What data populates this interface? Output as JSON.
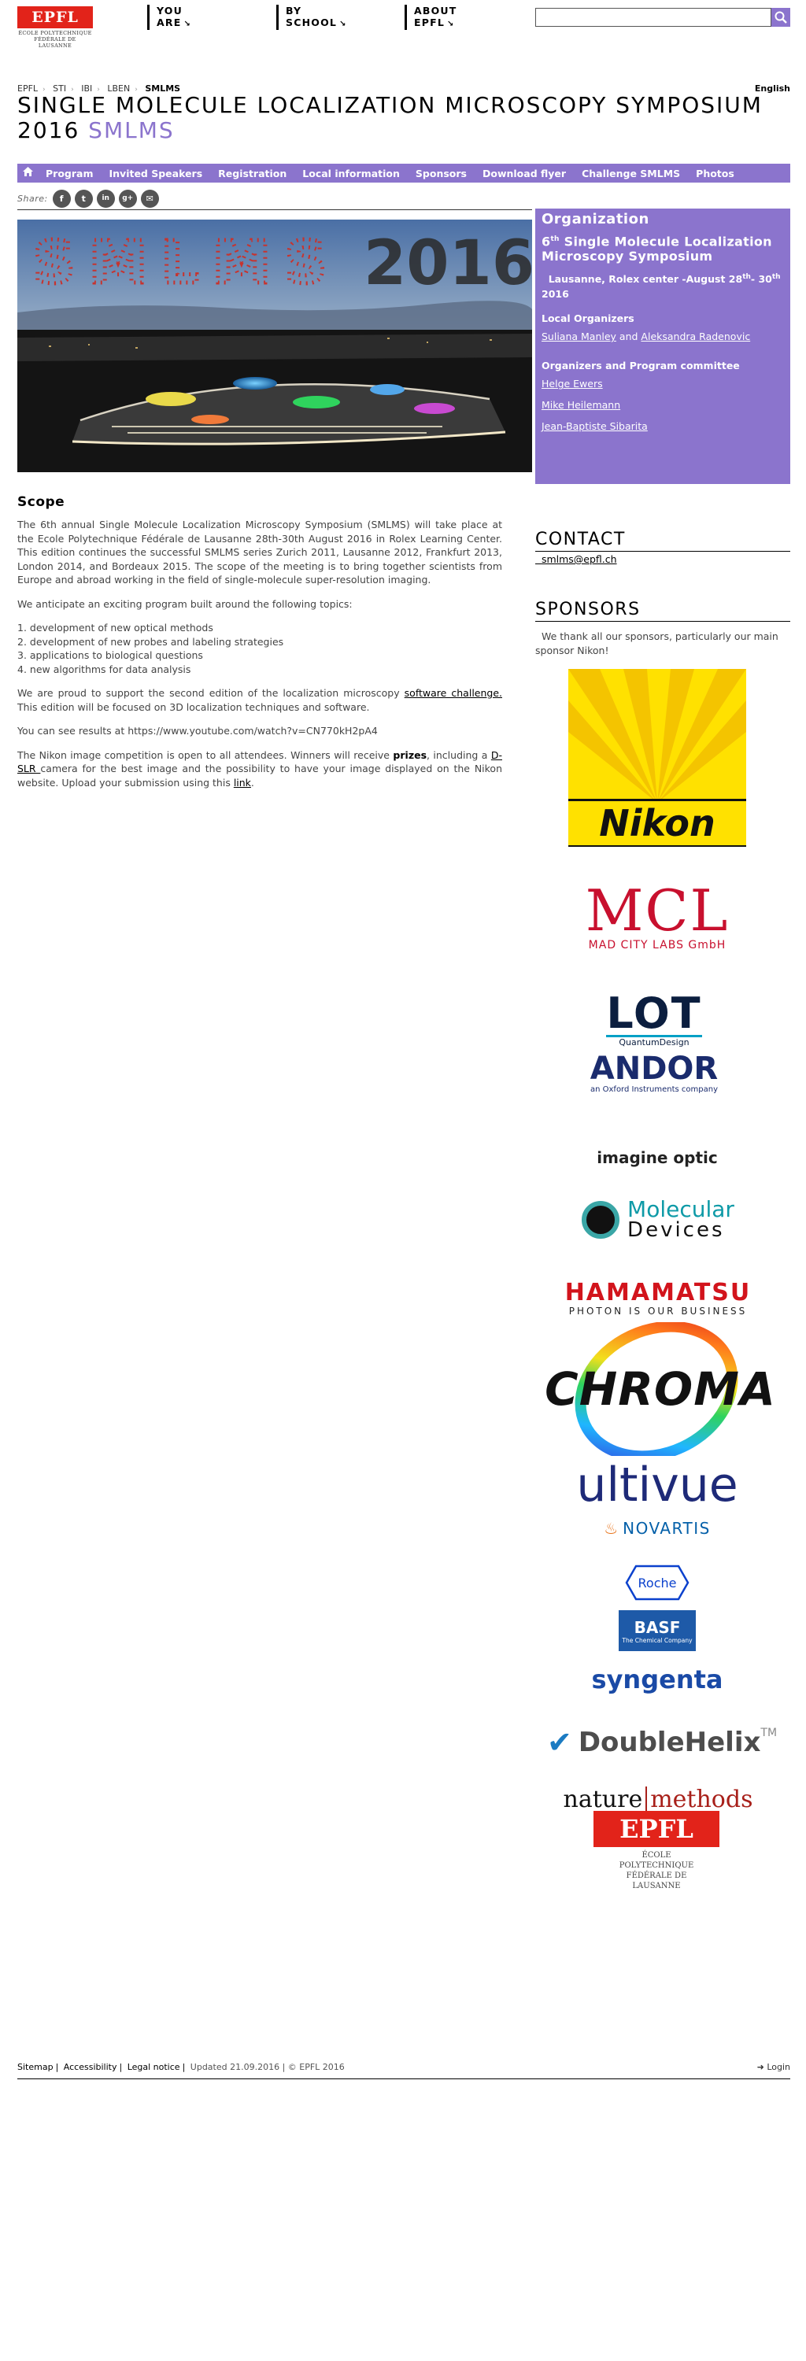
{
  "header": {
    "logo": {
      "mark": "EPFL",
      "sub": "ÉCOLE POLYTECHNIQUE FÉDÉRALE DE LAUSANNE"
    },
    "nav": [
      {
        "line1": "YOU",
        "line2": "ARE"
      },
      {
        "line1": "BY",
        "line2": "SCHOOL"
      },
      {
        "line1": "ABOUT",
        "line2": "EPFL"
      }
    ],
    "search": {
      "placeholder": ""
    }
  },
  "breadcrumb": [
    "EPFL",
    "STI",
    "IBI",
    "LBEN",
    "SMLMS"
  ],
  "language": "English",
  "title": {
    "main": "SINGLE MOLECULE LOCALIZATION MICROSCOPY SYMPOSIUM 2016",
    "accent": "SMLMS"
  },
  "main_nav": [
    "Program",
    "Invited Speakers",
    "Registration",
    "Local information",
    "Sponsors",
    "Download flyer",
    "Challenge SMLMS",
    "Photos"
  ],
  "share": {
    "label": "Share:",
    "icons": [
      "f",
      "t",
      "in",
      "g+",
      "✉"
    ]
  },
  "hero": {
    "word": "SMLMS",
    "year": "2016"
  },
  "scope": {
    "heading": "Scope",
    "p1": "The 6th annual Single Molecule Localization Microscopy Symposium (SMLMS) will take place at the Ecole Polytechnique Fédérale de Lausanne 28th-30th August 2016 in Rolex Learning Center. This edition continues the successful SMLMS series Zurich 2011, Lausanne 2012, Frankfurt 2013, London 2014, and Bordeaux 2015. The scope of the meeting is to bring together scientists from Europe and abroad working in the field of single-molecule super-resolution imaging.",
    "p2": "We anticipate an exciting program built around the following topics:",
    "topics": [
      "1. development of new optical methods",
      "2. development of new probes and labeling strategies",
      "3. applications to biological questions",
      "4. new algorithms for data analysis"
    ],
    "p3_before": "We are proud to support the second edition of the localization microscopy ",
    "p3_link": "software challenge.",
    "p3_after": " This edition will be focused on 3D localization techniques and software.",
    "p4": "You can see results at https://www.youtube.com/watch?v=CN770kH2pA4",
    "p5_a": "The Nikon image competition is open to all attendees. Winners will receive ",
    "p5_prizes": "prizes",
    "p5_b": ", including a ",
    "p5_dslr": "D-SLR ",
    "p5_c": " camera for the best image and the possibility to have your image displayed on the Nikon website. Upload your submission using this ",
    "p5_link": "link",
    "p5_d": "."
  },
  "organization": {
    "heading": "Organization",
    "event_prefix": "6",
    "event_sup": "th",
    "event_rest": " Single Molecule Localization Microscopy Symposium",
    "loc_a": "Lausanne, Rolex center  -August 28",
    "loc_sup1": "th",
    "loc_b": "- 30",
    "loc_sup2": "th",
    "loc_c": " 2016",
    "local_heading": "Local Organizers",
    "local_1": "Suliana Manley",
    "local_and": " and ",
    "local_2": "Aleksandra Radenovic",
    "committee_heading": "Organizers and Program committee",
    "committee": [
      "Helge Ewers",
      "Mike Heilemann ",
      "Jean-Baptiste Sibarita "
    ]
  },
  "contact": {
    "heading": "CONTACT",
    "email": "smlms@epfl.ch"
  },
  "sponsors": {
    "heading": "SPONSORS",
    "text": "We thank all our sponsors, particularly our main sponsor Nikon!",
    "logos": {
      "nikon": "Nikon",
      "mcl": "MCL",
      "mcl_sub": "MAD CITY LABS GmbH",
      "lot": "LOT",
      "lot_sub": "QuantumDesign",
      "andor": "ANDOR",
      "andor_sub": "an Oxford Instruments company",
      "imagine": "imagine optic",
      "molecular_1": "Molecular",
      "molecular_2": "Devices",
      "hamamatsu": "HAMAMATSU",
      "hamamatsu_sub": "PHOTON IS OUR BUSINESS",
      "chroma": "CHROMA",
      "ultivue": "ultivue",
      "novartis": "NOVARTIS",
      "roche": "Roche",
      "basf": "BASF",
      "basf_sub": "The Chemical Company",
      "syngenta": "syngenta",
      "doublehelix": "DoubleHelix",
      "nature": "nature",
      "methods": "methods",
      "epfl": "EPFL",
      "epfl_sub": "ÉCOLE POLYTECHNIQUE FÉDÉRALE DE LAUSANNE"
    }
  },
  "footer": {
    "links": [
      "Sitemap",
      "Accessibility",
      "Legal notice"
    ],
    "updated": "Updated 21.09.2016 | © EPFL 2016",
    "login": "Login"
  },
  "colors": {
    "accent": "#8b74cd",
    "epfl_red": "#e2231a"
  }
}
